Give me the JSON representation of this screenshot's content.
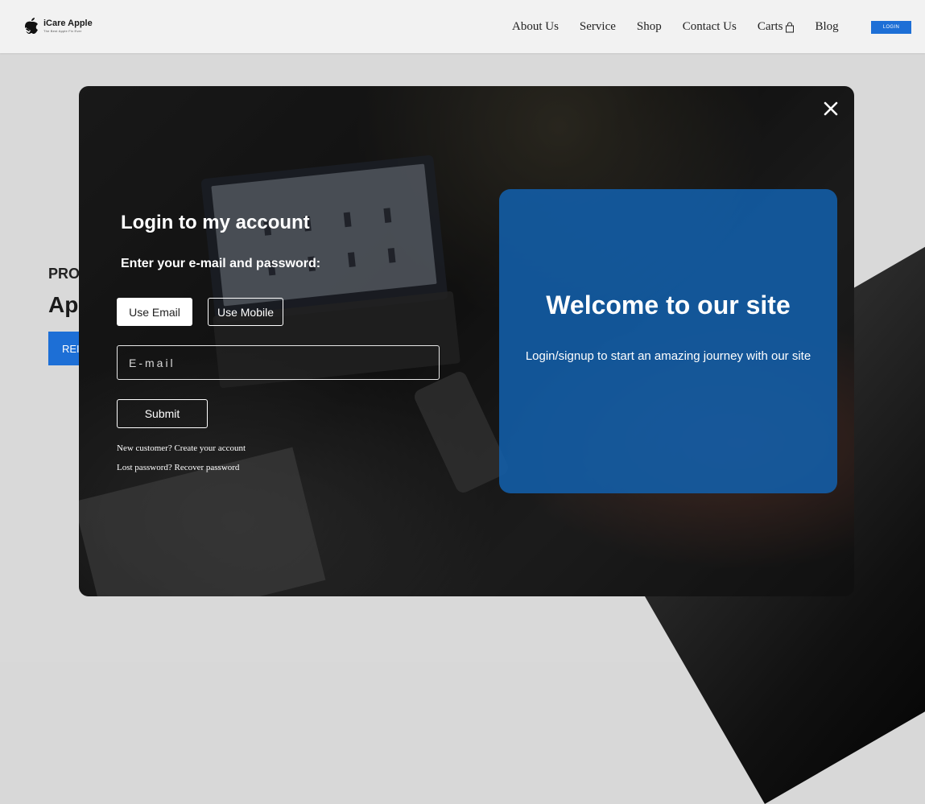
{
  "brand": {
    "name": "iCare Apple",
    "tagline": "The Best Apple Fix Ever"
  },
  "nav": {
    "links": [
      "About Us",
      "Service",
      "Shop",
      "Contact Us",
      "Carts",
      "Blog"
    ],
    "login_label": "LOGIN"
  },
  "hero": {
    "eyebrow": "PRO",
    "title": "Ap",
    "button": "REI"
  },
  "modal": {
    "title": "Login to my account",
    "subtitle": "Enter your e-mail and password:",
    "tabs": [
      "Use Email",
      "Use Mobile"
    ],
    "email_placeholder": "E-mail",
    "submit_label": "Submit",
    "new_customer": "New customer? Create your account",
    "lost_password": "Lost password? Recover password",
    "welcome_title": "Welcome to our site",
    "welcome_desc": "Login/signup to start an amazing journey with our site"
  },
  "colors": {
    "accent": "#1d6fd6",
    "welcome_panel": "#125faa"
  },
  "icons": {
    "logo": "apple-logo-icon",
    "cart": "bag-icon",
    "close": "close-icon"
  }
}
